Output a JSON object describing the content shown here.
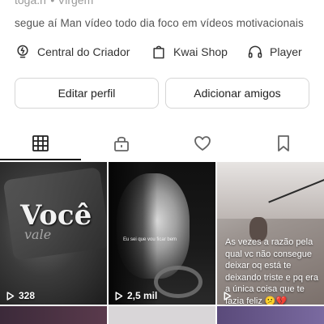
{
  "profile": {
    "meta_partial": "toga.rr  •  Virgem",
    "bio": "segue aí Man vídeo todo dia foco em vídeos motivacionais"
  },
  "links": [
    {
      "label": "Central do Criador",
      "icon": "lightbulb-icon"
    },
    {
      "label": "Kwai Shop",
      "icon": "shopping-bag-icon"
    },
    {
      "label": "Player",
      "icon": "headphones-icon"
    }
  ],
  "actions": {
    "edit_label": "Editar perfil",
    "add_label": "Adicionar amigos"
  },
  "tabs": [
    {
      "name": "grid",
      "icon": "grid-icon",
      "active": true
    },
    {
      "name": "private",
      "icon": "lock-icon",
      "active": false
    },
    {
      "name": "liked",
      "icon": "heart-icon",
      "active": false
    },
    {
      "name": "saved",
      "icon": "bookmark-icon",
      "active": false
    }
  ],
  "videos": [
    {
      "views": "328",
      "overlay_title": "Você",
      "overlay_sub": "vale"
    },
    {
      "views": "2,5 mil",
      "overlay_caption": "Eu sei que vou ficar bem"
    },
    {
      "views": "",
      "overlay_text": "As vezes a razão pela qual vc não consegue deixar oq está te deixando triste e pq era a única coisa que te fazia feliz 😕💔"
    }
  ],
  "colors": {
    "text_primary": "#222222",
    "text_secondary": "#555555",
    "border": "#d6d6d6",
    "tab_indicator": "#111111"
  }
}
